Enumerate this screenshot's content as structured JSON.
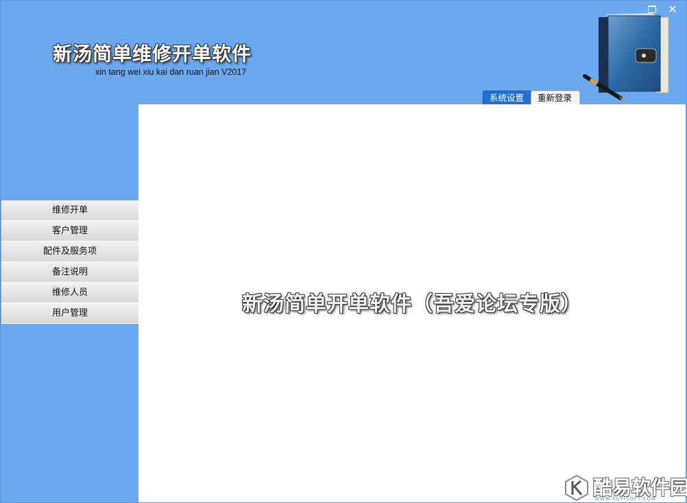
{
  "header": {
    "title": "新汤简单维修开单软件",
    "subtitle": "xin tang wei xiu kai dan ruan jian  V2017",
    "tabs": [
      {
        "label": "系统设置"
      },
      {
        "label": "重新登录"
      }
    ]
  },
  "window_controls": {
    "close": "✕"
  },
  "sidebar": {
    "items": [
      {
        "label": "维修开单"
      },
      {
        "label": "客户管理"
      },
      {
        "label": "配件及服务项"
      },
      {
        "label": "备注说明"
      },
      {
        "label": "维修人员"
      },
      {
        "label": "用户管理"
      }
    ]
  },
  "main": {
    "center_text": "新汤简单开单软件（吾爱论坛专版）"
  },
  "watermark": {
    "name": "酷易软件园",
    "url": "WWW.KUYISOFT.COM"
  },
  "colors": {
    "background": "#6aa8f0",
    "content": "#ffffff",
    "tab_active": "#1f71d8"
  },
  "icons": {
    "book": "book-icon",
    "pen": "pen-icon",
    "maximize": "maximize-icon",
    "close": "close-icon",
    "logo": "k-logo-icon"
  }
}
